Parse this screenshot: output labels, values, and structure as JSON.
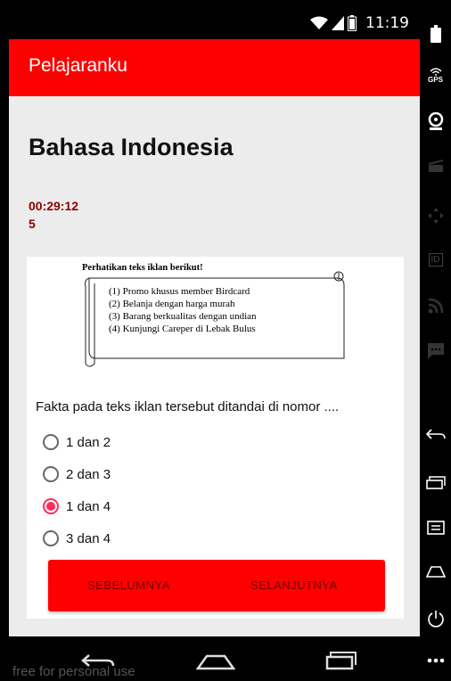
{
  "status_bar": {
    "time": "11:19"
  },
  "app_bar": {
    "title": "Pelajaranku"
  },
  "page": {
    "subject_title": "Bahasa Indonesia",
    "timer": "00:29:12",
    "question_number": "5"
  },
  "question_image": {
    "heading": "Perhatikan teks iklan berikut!",
    "lines": [
      "(1) Promo khusus member Birdcard",
      "(2) Belanja dengan harga murah",
      "(3) Barang berkualitas dengan undian",
      "(4) Kunjungi Careper di Lebak Bulus"
    ]
  },
  "question": {
    "text": "Fakta pada teks iklan tersebut ditandai di nomor ....",
    "options": [
      {
        "label": "1 dan 2",
        "selected": false
      },
      {
        "label": "2 dan 3",
        "selected": false
      },
      {
        "label": "1 dan 4",
        "selected": true
      },
      {
        "label": "3 dan 4",
        "selected": false
      }
    ]
  },
  "buttons": {
    "previous": "SEBELUMNYA",
    "next": "SELANJUTNYA"
  },
  "watermark": "free for personal use",
  "side_panel": {
    "gps_label": "GPS",
    "id_label": "ID"
  },
  "colors": {
    "app_bar": "#ff0000",
    "radio_selected": "#ff2e5b",
    "timer": "#8b0000"
  }
}
